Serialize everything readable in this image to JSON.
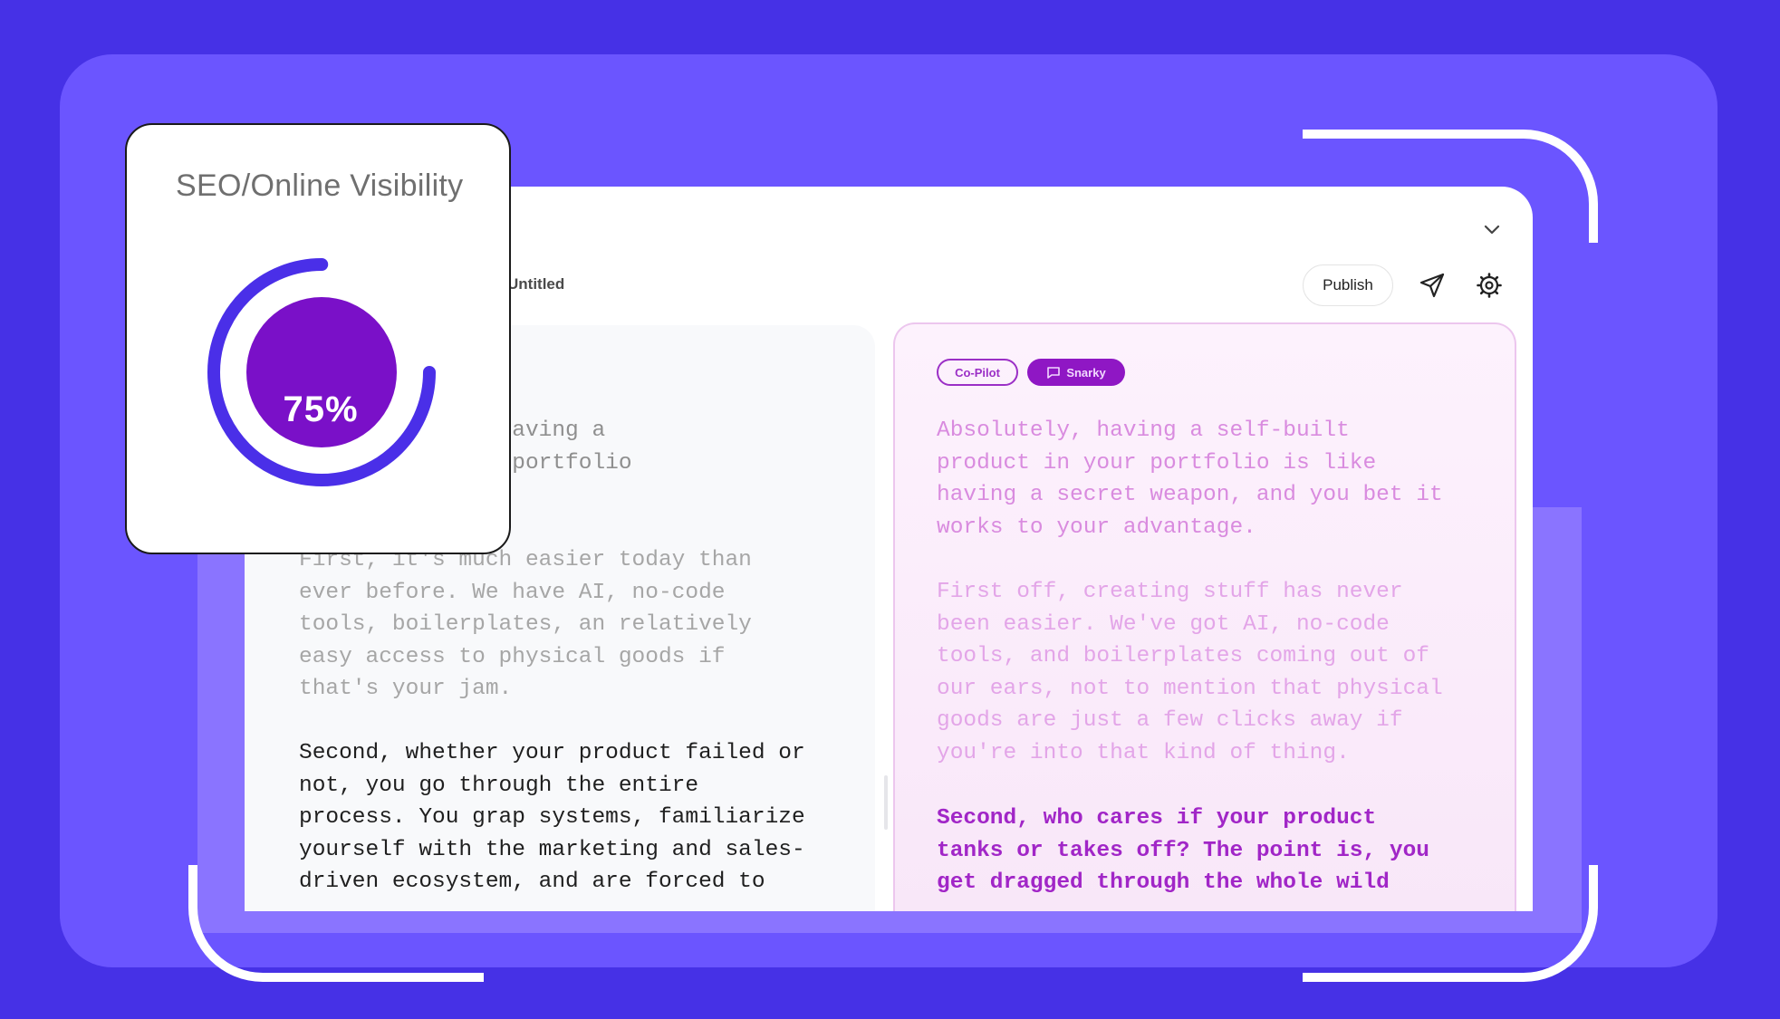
{
  "seo_card": {
    "title": "SEO/Online Visibility",
    "value_label": "75%",
    "value_fraction": 0.75,
    "ring_color": "#4a2fe8",
    "fill_color": "#7a10c8"
  },
  "editor": {
    "document_title": "Untitled",
    "publish_label": "Publish",
    "icons": [
      "chevron-down-icon",
      "send-icon",
      "settings-icon"
    ]
  },
  "left_pane": {
    "paragraphs": [
      "I believe that having a\nproduct in your portfolio\nadvantage.",
      "First, it's much easier today than\never before. We have AI, no-code\ntools, boilerplates, an relatively\neasy access to physical goods if\nthat's your jam.",
      "Second, whether your product failed or\nnot, you go through the entire\nprocess. You grap systems, familiarize\nyourself with the marketing and sales-\ndriven ecosystem, and are forced to"
    ]
  },
  "right_pane": {
    "mode_pills": [
      "Co-Pilot",
      "Snarky"
    ],
    "paragraphs": [
      "Absolutely, having a self-built\nproduct in your portfolio is like\nhaving a secret weapon, and you bet it\nworks to your advantage.",
      "First off, creating stuff has never\nbeen easier. We've got AI, no-code\ntools, and boilerplates coming out of\nour ears, not to mention that physical\ngoods are just a few clicks away if\nyou're into that kind of thing.",
      "Second, who cares if your product\ntanks or takes off? The point is, you\nget dragged through the whole wild"
    ]
  },
  "colors": {
    "background": "#4631e6",
    "panel": "#6b55ff",
    "accent_purple": "#8f17c4"
  }
}
